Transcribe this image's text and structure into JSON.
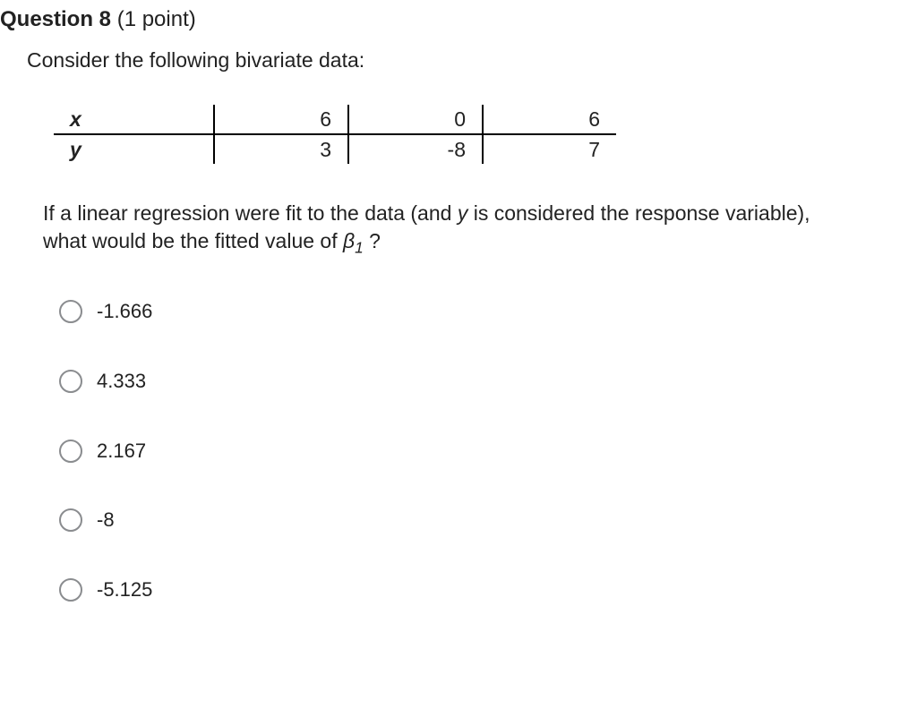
{
  "question": {
    "title": "Question 8",
    "points": "(1 point)",
    "prompt": "Consider the following bivariate data:",
    "follow_pre": "If a linear regression were fit to the data (and ",
    "follow_y": "y",
    "follow_mid": " is considered the response variable), what would be the fitted value of ",
    "follow_beta": "β",
    "follow_sub": "1",
    "follow_post": " ?"
  },
  "table": {
    "labels": {
      "x": "x",
      "y": "y"
    },
    "x": [
      "6",
      "0",
      "6"
    ],
    "y": [
      "3",
      "-8",
      "7"
    ]
  },
  "options": [
    {
      "label": "-1.666"
    },
    {
      "label": "4.333"
    },
    {
      "label": "2.167"
    },
    {
      "label": "-8"
    },
    {
      "label": "-5.125"
    }
  ],
  "chart_data": {
    "type": "table",
    "title": "Bivariate data",
    "columns": [
      "x",
      "y"
    ],
    "rows": [
      {
        "x": 6,
        "y": 3
      },
      {
        "x": 0,
        "y": -8
      },
      {
        "x": 6,
        "y": 7
      }
    ]
  }
}
